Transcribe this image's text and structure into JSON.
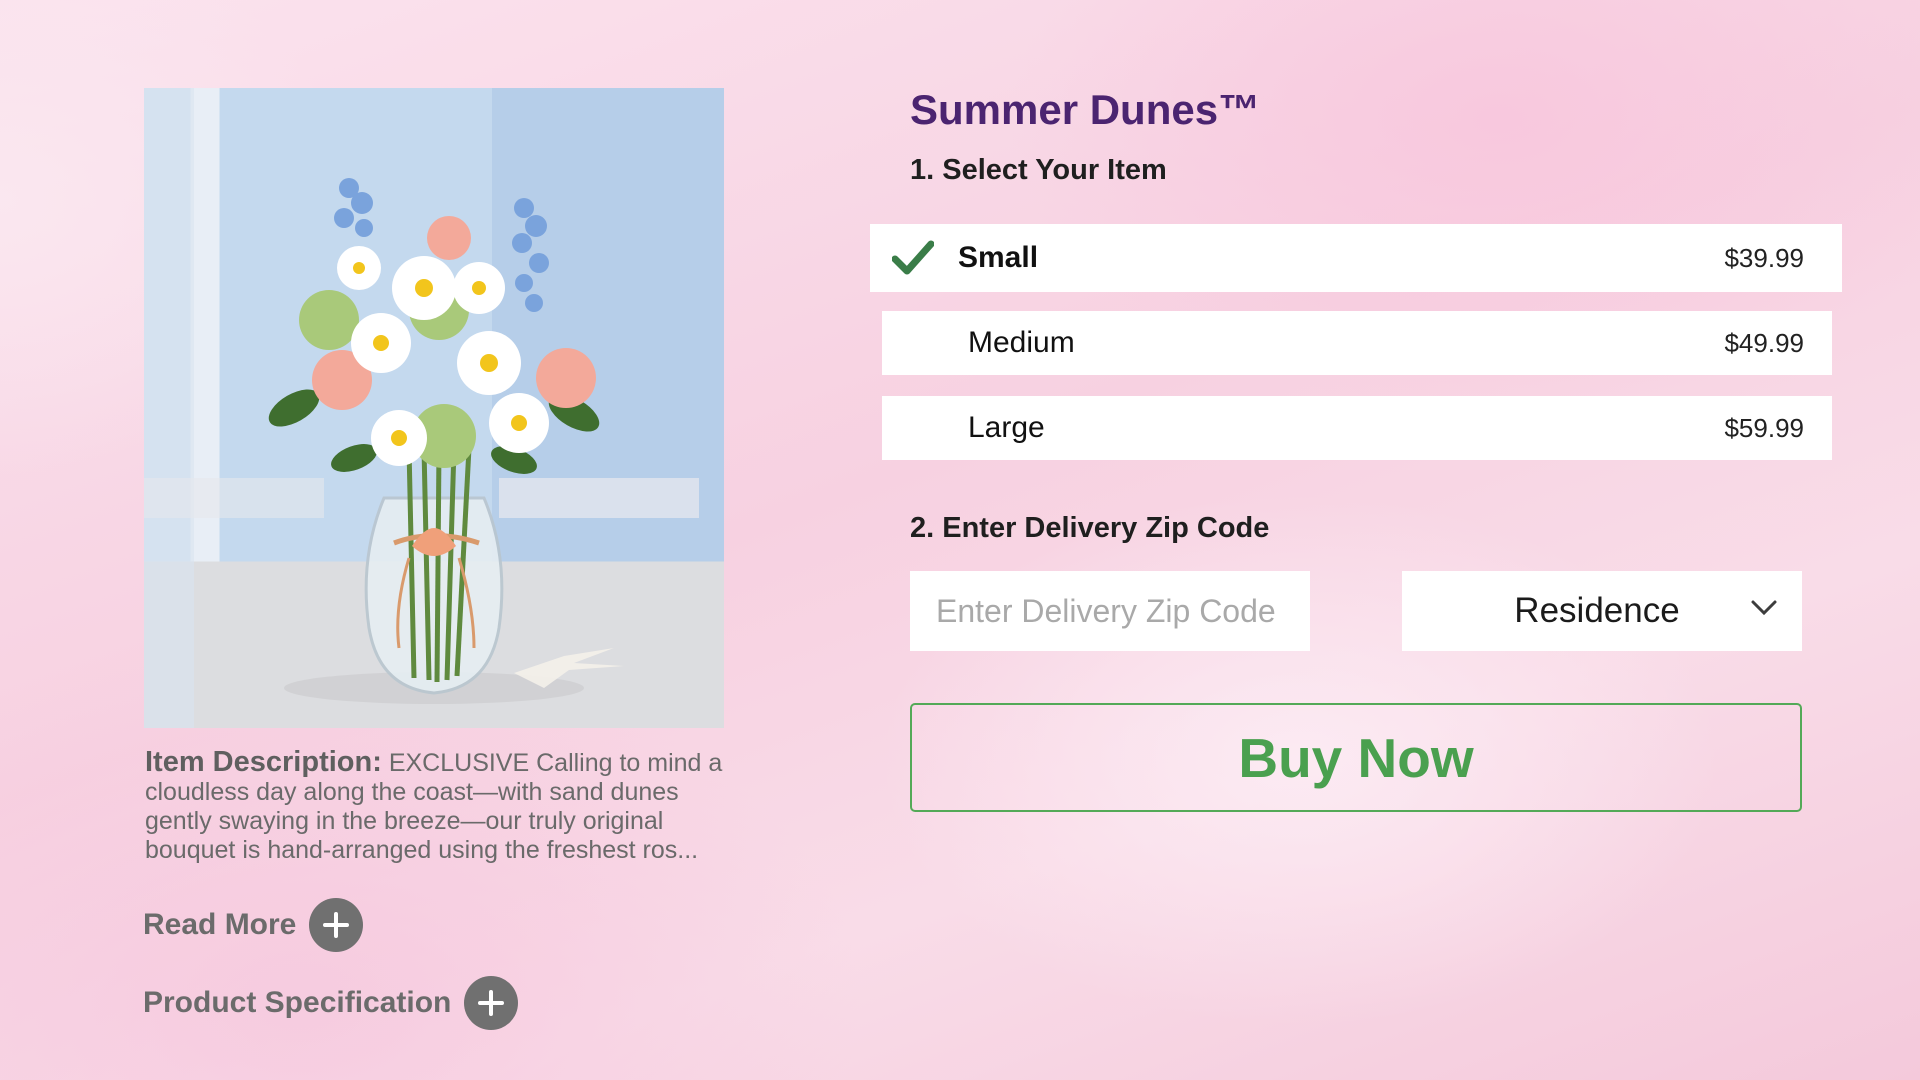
{
  "product": {
    "title": "Summer Dunes™",
    "image_alt": "Bouquet of daisies, carnations and delphinium in a glass vase with a seashell"
  },
  "description": {
    "label": "Item Description:",
    "text": "EXCLUSIVE Calling to mind a cloudless day along the coast—with sand dunes gently swaying in the breeze—our truly original bouquet is hand-arranged using the freshest ros..."
  },
  "expanders": {
    "read_more": "Read More",
    "product_specification": "Product Specification"
  },
  "step1": {
    "label": "1. Select Your Item",
    "options": [
      {
        "name": "Small",
        "price": "$39.99",
        "selected": true
      },
      {
        "name": "Medium",
        "price": "$49.99",
        "selected": false
      },
      {
        "name": "Large",
        "price": "$59.99",
        "selected": false
      }
    ]
  },
  "step2": {
    "label": "2. Enter Delivery Zip Code",
    "zip_placeholder": "Enter Delivery Zip Code",
    "zip_value": "",
    "location_type": "Residence"
  },
  "buy_button": {
    "label": "Buy Now"
  },
  "colors": {
    "title": "#4b2470",
    "accent_green": "#4aa04f",
    "check_green": "#3a7d48",
    "plus_button": "#707070"
  },
  "icons": {
    "check": "check-icon",
    "plus": "plus-icon",
    "dropdown": "chevron-down-icon"
  }
}
